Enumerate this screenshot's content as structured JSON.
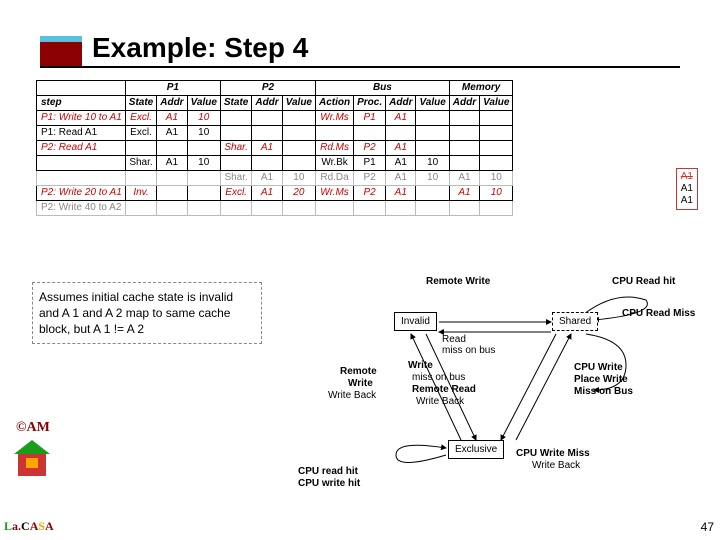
{
  "title": "Example: Step 4",
  "table": {
    "hdr_groups": [
      "",
      "P1",
      "P2",
      "Bus",
      "Memory"
    ],
    "hdr_cols": [
      "step",
      "State",
      "Addr",
      "Value",
      "State",
      "Addr",
      "Value",
      "Action",
      "Proc.",
      "Addr",
      "Value",
      "Addr",
      "Value"
    ],
    "rows": [
      {
        "cells": [
          "P1: Write 10 to A1",
          "Excl.",
          "A1",
          "10",
          "",
          "",
          "",
          "Wr.Ms",
          "P1",
          "A1",
          "",
          "",
          ""
        ],
        "red": true
      },
      {
        "cells": [
          "P1: Read A1",
          "Excl.",
          "A1",
          "10",
          "",
          "",
          "",
          "",
          "",
          "",
          "",
          "",
          ""
        ],
        "red": false
      },
      {
        "cells": [
          "P2: Read A1",
          "",
          "",
          "",
          "Shar.",
          "A1",
          "",
          "Rd.Ms",
          "P2",
          "A1",
          "",
          "",
          ""
        ],
        "red": true
      },
      {
        "cells": [
          "",
          "Shar.",
          "A1",
          "10",
          "",
          "",
          "",
          "Wr.Bk",
          "P1",
          "A1",
          "10",
          "",
          ""
        ],
        "red": false
      },
      {
        "cells": [
          "",
          "",
          "",
          "",
          "Shar.",
          "A1",
          "10",
          "Rd.Da",
          "P2",
          "A1",
          "10",
          "A1",
          "10"
        ],
        "gray": true
      },
      {
        "cells": [
          "P2: Write 20 to A1",
          "Inv.",
          "",
          "",
          "Excl.",
          "A1",
          "20",
          "Wr.Ms",
          "P2",
          "A1",
          "",
          "A1",
          "10"
        ],
        "red": true
      },
      {
        "cells": [
          "P2: Write 40 to A2",
          "",
          "",
          "",
          "",
          "",
          "",
          "",
          "",
          "",
          "",
          "",
          ""
        ],
        "gray": true
      }
    ]
  },
  "float": {
    "l1": "A1",
    "l2": "A1",
    "l3": "A1"
  },
  "assume": "Assumes initial cache state is invalid and A 1 and A 2 map to same cache block, but A 1 !=  A 2",
  "diagram": {
    "invalid": "Invalid",
    "shared": "Shared",
    "exclusive": "Exclusive",
    "remote_write_top": "Remote Write",
    "cpu_read_hit": "CPU Read hit",
    "cpu_read_miss": "CPU Read Miss",
    "read_miss_bus": "Read\nmiss on bus",
    "write": "Write",
    "miss_on_bus": "miss on bus",
    "remote": "Remote",
    "write2": "Write",
    "write_back": "Write Back",
    "remote_read": "Remote Read",
    "write_back2": "Write Back",
    "cpu_write": "CPU Write",
    "place_write": "Place Write",
    "miss_on_bus2": "Miss on Bus",
    "cpu_write_miss": "CPU Write Miss",
    "write_back3": "Write Back",
    "cpu_read_hit2": "CPU read hit",
    "cpu_write_hit": "CPU write hit"
  },
  "am": "©AM",
  "lacasa": {
    "l": "L",
    "a1": "a.",
    "c": "C",
    "a2": "A",
    "s": "S",
    "a3": "A"
  },
  "pagenum": "47"
}
